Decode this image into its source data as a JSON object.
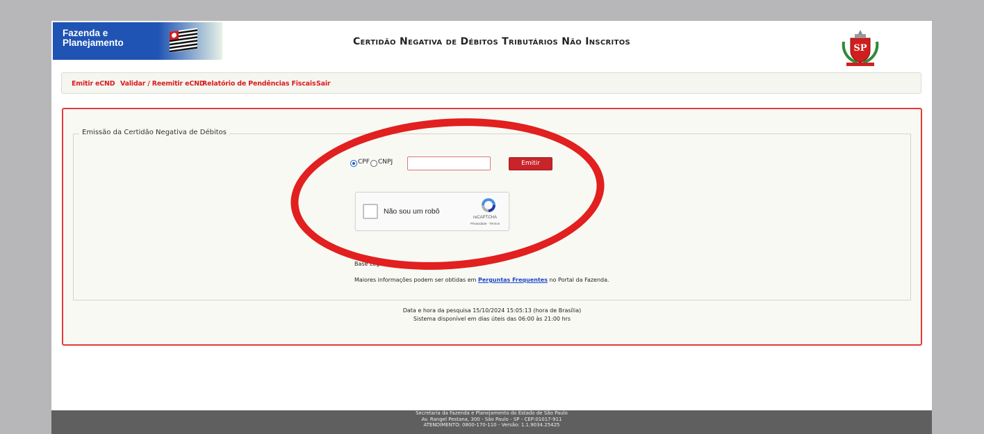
{
  "header": {
    "brand_line1": "Fazenda e",
    "brand_line2": "Planejamento",
    "title": "Certidão Negativa de Débitos Tributários Não Inscritos"
  },
  "nav": {
    "items": [
      {
        "label": "Emitir eCND"
      },
      {
        "label": "Validar / Reemitir eCND"
      },
      {
        "label": "Relatório de Pendências Fiscais"
      },
      {
        "label": "Sair"
      }
    ]
  },
  "form": {
    "legend": "Emissão da Certidão Negativa de Débitos",
    "radio_cpf": "CPF",
    "radio_cnpj": "CNPJ",
    "selected_radio": "CPF",
    "document_value": "",
    "emitir_label": "Emitir",
    "recaptcha": {
      "label": "Não sou um robô",
      "brand": "reCAPTCHA",
      "links": "Privacidade - Termos"
    },
    "base_legal_label": "Base Legal:",
    "more_info_prefix": "Maiores informações podem ser obtidas em",
    "more_info_link": "Perguntas Frequentes",
    "more_info_suffix": "no Portal da Fazenda."
  },
  "status": {
    "timestamp_line": "Data e hora da pesquisa 15/10/2024 15:05:13 (hora de Brasília)",
    "availability_line": "Sistema disponível em dias úteis das 06:00 às 21:00 hrs"
  },
  "footer": {
    "line1": "Secretaria da Fazenda e Planejamento do Estado de São Paulo",
    "line2": "Av. Rangel Pestana, 300 - São Paulo - SP - CEP:01017-911",
    "line3": "ATENDIMENTO: 0800-170-110 - Versão: 1.1.9034.25425"
  },
  "colors": {
    "brand_blue": "#1f54b4",
    "accent_red": "#d81e1e",
    "annotation_red": "#e1201f"
  }
}
